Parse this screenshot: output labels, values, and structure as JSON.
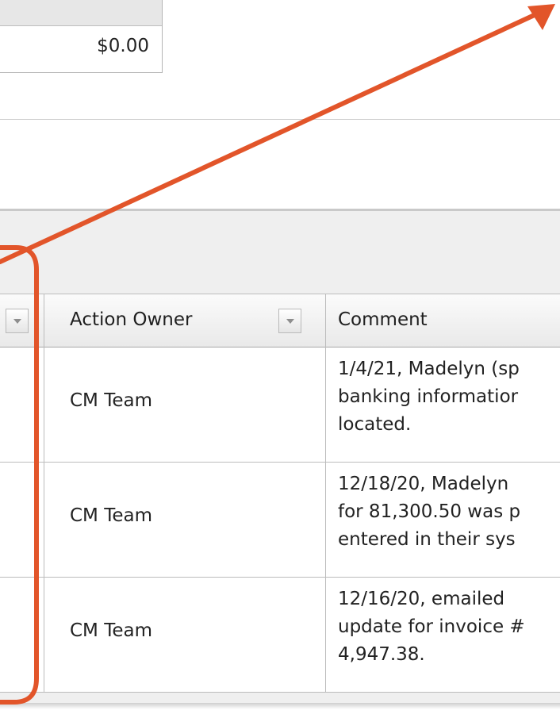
{
  "summary": {
    "amount": "$0.00"
  },
  "grid": {
    "columns": {
      "action_owner": "Action Owner",
      "comment": "Comment"
    },
    "rows": [
      {
        "action_owner": "CM Team",
        "comment": "1/4/21, Madelyn (sp\nbanking informatior\nlocated."
      },
      {
        "action_owner": "CM Team",
        "comment": "12/18/20, Madelyn\nfor 81,300.50 was p\nentered in their sys"
      },
      {
        "action_owner": "CM Team",
        "comment": "12/16/20, emailed \nupdate for invoice #\n4,947.38."
      }
    ]
  },
  "annotation": {
    "color": "#e2552a",
    "marks": [
      "callout-bracket",
      "arrow"
    ]
  }
}
